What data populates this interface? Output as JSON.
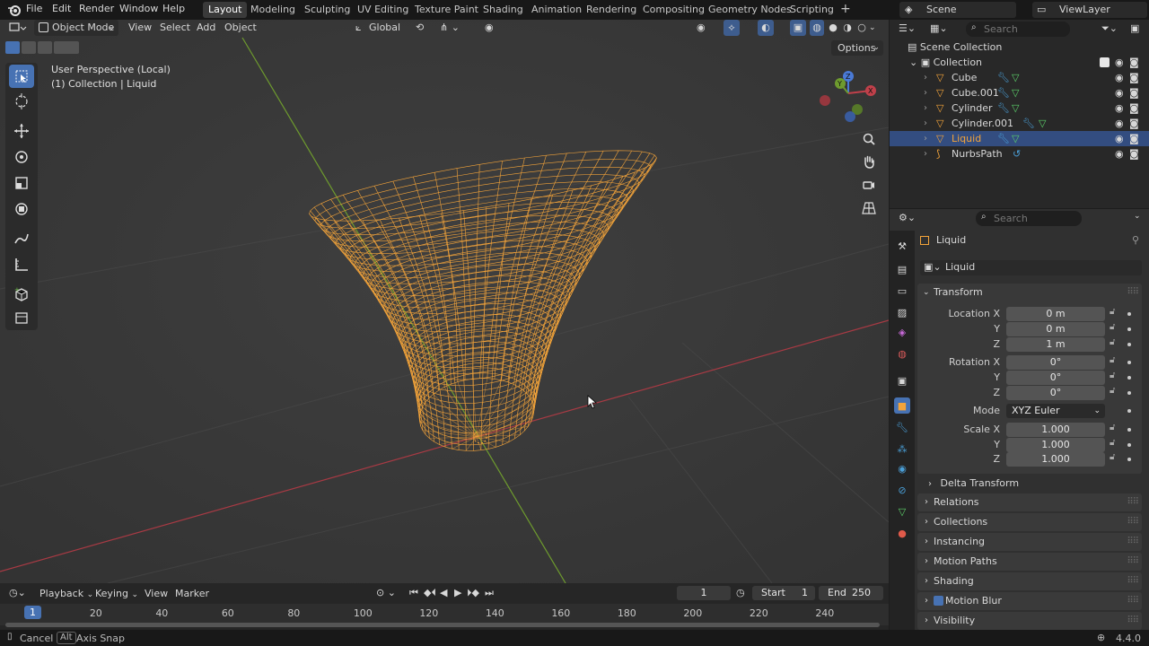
{
  "menubar": {
    "items": [
      "File",
      "Edit",
      "Render",
      "Window",
      "Help"
    ],
    "workspaces": [
      "Layout",
      "Modeling",
      "Sculpting",
      "UV Editing",
      "Texture Paint",
      "Shading",
      "Animation",
      "Rendering",
      "Compositing",
      "Geometry Nodes",
      "Scripting"
    ],
    "active_workspace": "Layout",
    "scene": "Scene",
    "view_layer": "ViewLayer"
  },
  "viewport": {
    "mode": "Object Mode",
    "menus": [
      "View",
      "Select",
      "Add",
      "Object"
    ],
    "orientation": "Global",
    "options_label": "Options",
    "info_line1": "User Perspective (Local)",
    "info_line2": "(1) Collection | Liquid",
    "gizmo_axes": {
      "x": "X",
      "y": "Y",
      "z": "Z"
    }
  },
  "outliner": {
    "search_placeholder": "Search",
    "root": "Scene Collection",
    "collection": "Collection",
    "items": [
      {
        "name": "Cube",
        "selected": false
      },
      {
        "name": "Cube.001",
        "selected": false
      },
      {
        "name": "Cylinder",
        "selected": false
      },
      {
        "name": "Cylinder.001",
        "selected": false
      },
      {
        "name": "Liquid",
        "selected": true
      },
      {
        "name": "NurbsPath",
        "selected": false
      }
    ]
  },
  "properties": {
    "search_placeholder": "Search",
    "object_title": "Liquid",
    "object_name": "Liquid",
    "transform": {
      "header": "Transform",
      "location_label": "Location X",
      "y_label": "Y",
      "z_label": "Z",
      "location": [
        "0 m",
        "0 m",
        "1 m"
      ],
      "rotation_label": "Rotation X",
      "rotation": [
        "0°",
        "0°",
        "0°"
      ],
      "mode_label": "Mode",
      "mode_value": "XYZ Euler",
      "scale_label": "Scale X",
      "scale": [
        "1.000",
        "1.000",
        "1.000"
      ]
    },
    "delta_transform": "Delta Transform",
    "panels": [
      "Relations",
      "Collections",
      "Instancing",
      "Motion Paths",
      "Shading",
      "Motion Blur",
      "Visibility"
    ]
  },
  "timeline": {
    "menus": [
      "Playback",
      "Keying",
      "View",
      "Marker"
    ],
    "current_frame": "1",
    "start_label": "Start",
    "start_value": "1",
    "end_label": "End",
    "end_value": "250",
    "ticks": [
      "1",
      "20",
      "40",
      "60",
      "80",
      "100",
      "120",
      "140",
      "160",
      "180",
      "200",
      "220",
      "240"
    ]
  },
  "statusbar": {
    "cancel": "Cancel",
    "alt_key": "Alt",
    "axis_snap": "Axis Snap",
    "version": "4.4.0"
  },
  "colors": {
    "accent": "#4772b3",
    "selection": "#334d80",
    "mesh_wire": "#f4a43a",
    "x_axis": "#c0404a",
    "y_axis": "#6e9b2e"
  }
}
